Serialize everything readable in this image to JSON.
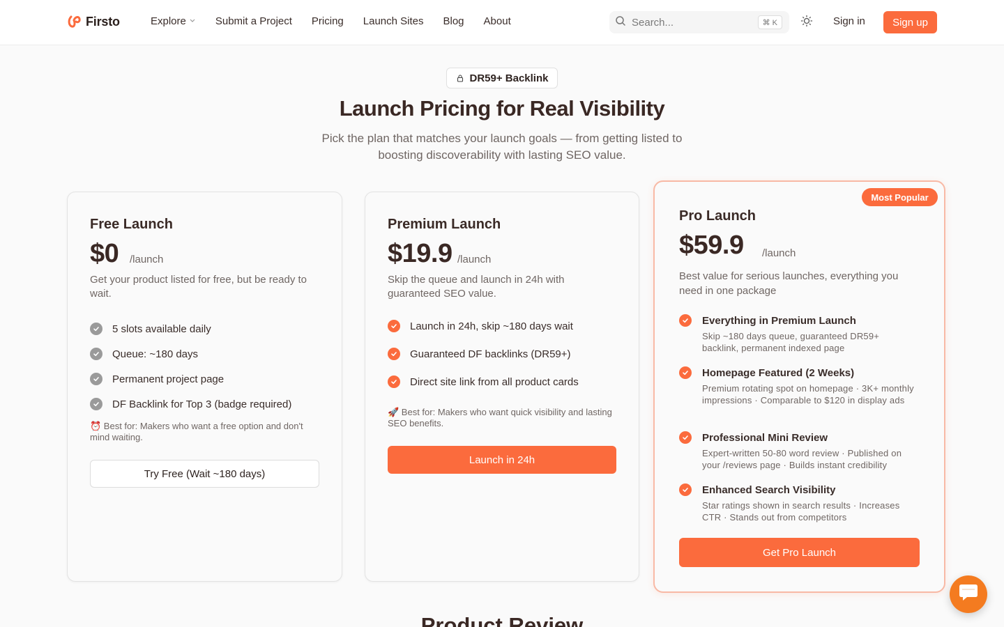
{
  "brand": {
    "name": "Firsto",
    "accent": "#fb6b3d"
  },
  "nav": {
    "items": [
      {
        "label": "Explore",
        "dropdown": true
      },
      {
        "label": "Submit a Project"
      },
      {
        "label": "Pricing"
      },
      {
        "label": "Launch Sites"
      },
      {
        "label": "Blog"
      },
      {
        "label": "About"
      }
    ]
  },
  "search": {
    "placeholder": "Search...",
    "shortcut": "⌘ K"
  },
  "auth": {
    "signin": "Sign in",
    "signup": "Sign up"
  },
  "hero": {
    "badge": "DR59+ Backlink",
    "title": "Launch Pricing for Real Visibility",
    "subtitle": "Pick the plan that matches your launch goals — from getting listed to boosting discoverability with lasting SEO value."
  },
  "plans": {
    "free": {
      "title": "Free Launch",
      "price": "$0",
      "per": "/launch",
      "description": "Get your product listed for free, but be ready to wait.",
      "features": [
        "5 slots available daily",
        "Queue: ~180 days",
        "Permanent project page",
        "DF Backlink for Top 3 (badge required)"
      ],
      "best_for": "⏰ Best for: Makers who want a free option and don't mind waiting.",
      "cta": "Try Free (Wait ~180 days)"
    },
    "premium": {
      "title": "Premium Launch",
      "price": "$19.9",
      "per": "/launch",
      "description": "Skip the queue and launch in 24h with guaranteed SEO value.",
      "features": [
        "Launch in 24h, skip ~180 days wait",
        "Guaranteed DF backlinks (DR59+)",
        "Direct site link from all product cards"
      ],
      "best_for": "🚀 Best for: Makers who want quick visibility and lasting SEO benefits.",
      "cta": "Launch in 24h"
    },
    "pro": {
      "tag": "Most Popular",
      "title": "Pro Launch",
      "price": "$59.9",
      "per": "/launch",
      "description": "Best value for serious launches, everything you need in one package",
      "features": [
        {
          "title": "Everything in Premium Launch",
          "detail": "Skip ~180 days queue, guaranteed DR59+ backlink, permanent indexed page"
        },
        {
          "title": "Homepage Featured (2 Weeks)",
          "detail": "Premium rotating spot on homepage · 3K+ monthly impressions · Comparable to $120 in display ads"
        },
        {
          "title": "Professional Mini Review",
          "detail": "Expert-written 50-80 word review · Published on your /reviews page · Builds instant credibility"
        },
        {
          "title": "Enhanced Search Visibility",
          "detail": "Star ratings shown in search results · Increases CTR · Stands out from competitors"
        }
      ],
      "cta": "Get Pro Launch"
    }
  },
  "next_section": {
    "title": "Product Review"
  },
  "icons": {
    "logo": "firsto-logo-icon",
    "chevron": "chevron-down-icon",
    "search": "search-icon",
    "theme": "sun-icon",
    "lock": "lock-icon",
    "check": "check-circle-icon",
    "chat": "chat-icon"
  }
}
